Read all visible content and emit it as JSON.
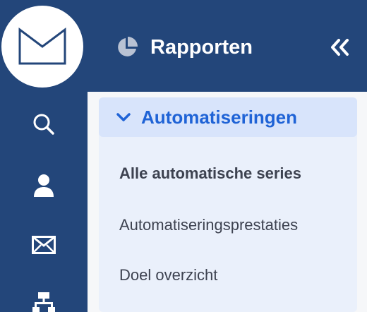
{
  "app": {
    "logo_icon": "mail-envelope-logo",
    "colors": {
      "navy": "#23467a",
      "accent_blue": "#1f63d6",
      "group_bg": "#eaf0fb",
      "group_header_bg": "#d8e4fb"
    }
  },
  "rail": {
    "items": [
      {
        "icon": "search-icon"
      },
      {
        "icon": "user-icon"
      },
      {
        "icon": "envelope-icon"
      },
      {
        "icon": "sitemap-icon"
      }
    ]
  },
  "header": {
    "icon": "pie-chart-icon",
    "title": "Rapporten",
    "collapse_icon": "double-chevron-left-icon"
  },
  "group": {
    "expanded": true,
    "title": "Automatiseringen",
    "items": [
      {
        "label": "Alle automatische series",
        "active": true
      },
      {
        "label": "Automatiseringsprestaties",
        "active": false
      },
      {
        "label": "Doel overzicht",
        "active": false
      }
    ]
  }
}
